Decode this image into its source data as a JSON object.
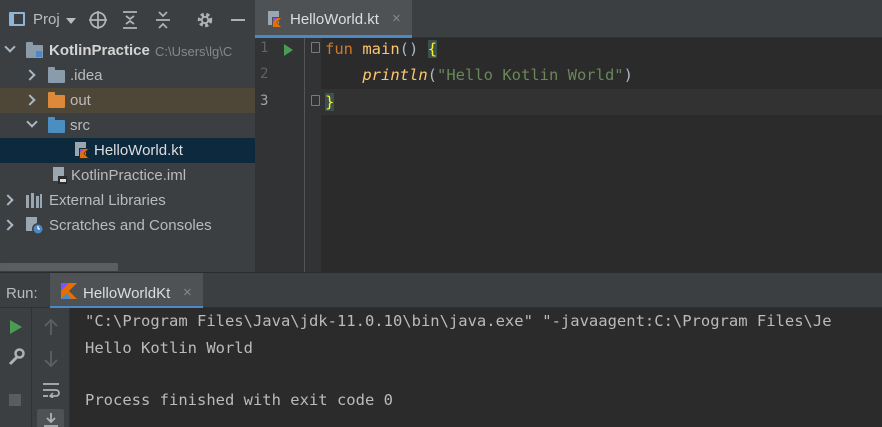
{
  "project": {
    "title": "Proj",
    "tree": [
      {
        "label": "KotlinPractice",
        "path": "C:\\Users\\lg\\C",
        "expanded": true
      },
      {
        "label": ".idea",
        "expanded": false
      },
      {
        "label": "out",
        "expanded": false
      },
      {
        "label": "src",
        "expanded": true
      },
      {
        "label": "HelloWorld.kt"
      },
      {
        "label": "KotlinPractice.iml"
      },
      {
        "label": "External Libraries",
        "expanded": false
      },
      {
        "label": "Scratches and Consoles",
        "expanded": false
      }
    ]
  },
  "editor": {
    "tab_label": "HelloWorld.kt",
    "tab_close": "×",
    "line_numbers": [
      "1",
      "2",
      "3"
    ],
    "code": {
      "l1_kw": "fun",
      "l1_name": "main",
      "l1_parens": "()",
      "l1_brace": "{",
      "l2_indent": "    ",
      "l2_fn": "println",
      "l2_open": "(",
      "l2_str": "\"Hello Kotlin World\"",
      "l2_close": ")",
      "l3_brace": "}"
    }
  },
  "run": {
    "label": "Run:",
    "tab_label": "HelloWorldKt",
    "tab_close": "×",
    "console": [
      "\"C:\\Program Files\\Java\\jdk-11.0.10\\bin\\java.exe\" \"-javaagent:C:\\Program Files\\Je",
      "Hello Kotlin World",
      "",
      "Process finished with exit code 0"
    ]
  },
  "colors": {
    "keyword": "#cc7832",
    "function": "#ffc66d",
    "string": "#6a8759",
    "accent": "#4a88c7",
    "run_green": "#499c54"
  }
}
